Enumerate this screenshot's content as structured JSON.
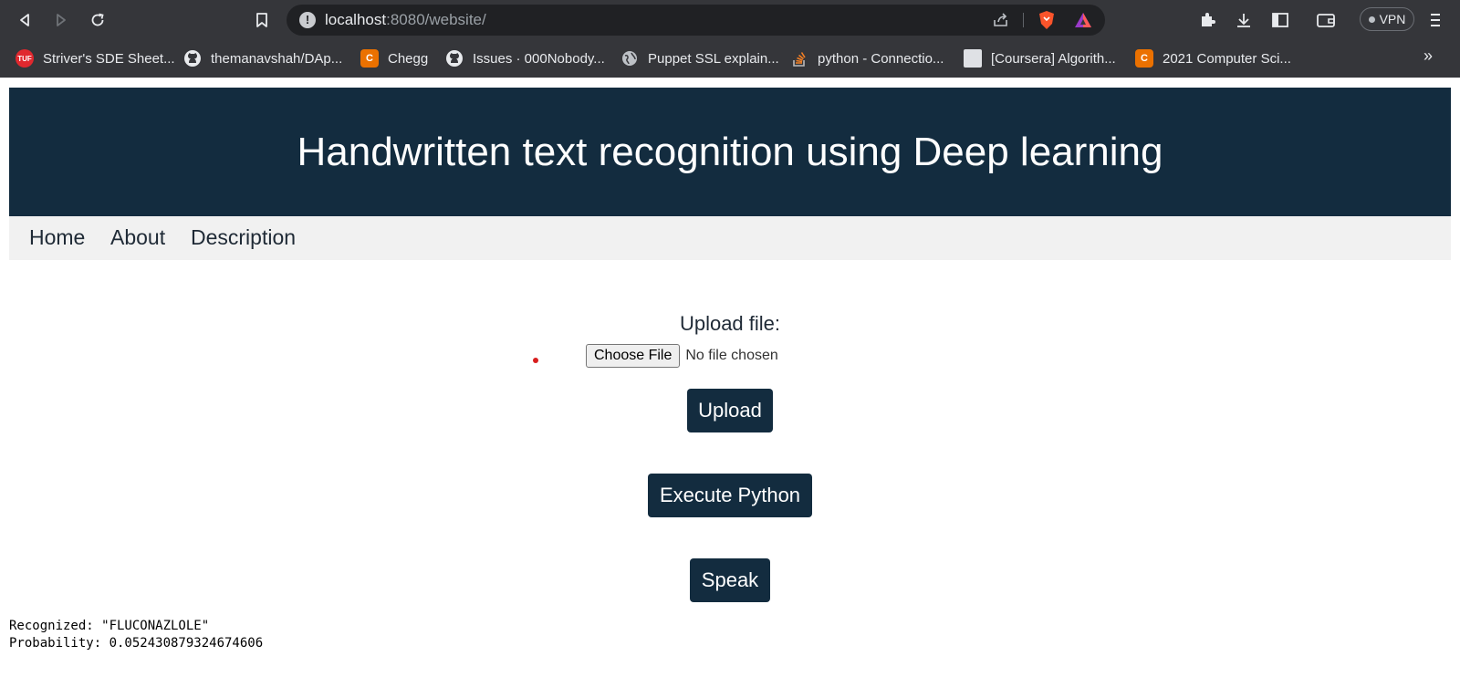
{
  "browser": {
    "url_host": "localhost",
    "url_rest": ":8080/website/",
    "vpn_label": "VPN",
    "bookmarks": [
      {
        "label": "Striver's SDE Sheet...",
        "icon": "tuf-icon",
        "color": "#e0282e",
        "glyph": "TUF"
      },
      {
        "label": "themanavshah/DAp...",
        "icon": "github-icon",
        "color": "#35363a",
        "glyph": ""
      },
      {
        "label": "Chegg",
        "icon": "chegg-icon",
        "color": "#eb7100",
        "glyph": "C"
      },
      {
        "label": "Issues · 000Nobody...",
        "icon": "github-icon",
        "color": "#35363a",
        "glyph": ""
      },
      {
        "label": "Puppet SSL explain...",
        "icon": "globe-icon",
        "color": "#35363a",
        "glyph": ""
      },
      {
        "label": "python - Connectio...",
        "icon": "stackoverflow-icon",
        "color": "#35363a",
        "glyph": ""
      },
      {
        "label": "[Coursera] Algorith...",
        "icon": "coursera-icon",
        "color": "#dfe1e5",
        "glyph": ""
      },
      {
        "label": "2021 Computer Sci...",
        "icon": "chegg-icon",
        "color": "#eb7100",
        "glyph": "C"
      }
    ],
    "bookmarks_more": "»"
  },
  "page": {
    "title": "Handwritten text recognition using Deep learning",
    "nav": [
      "Home",
      "About",
      "Description"
    ],
    "upload_label": "Upload file:",
    "choose_file_label": "Choose File",
    "file_status": "No file chosen",
    "upload_button": "Upload",
    "execute_button": "Execute Python",
    "speak_button": "Speak",
    "output_line1": "Recognized: \"FLUCONAZLOLE\"",
    "output_line2": "Probability: 0.052430879324674606"
  },
  "colors": {
    "banner": "#132c3f",
    "navbar": "#f1f1f1",
    "button": "#132c3f",
    "browser_chrome": "#35363a"
  }
}
